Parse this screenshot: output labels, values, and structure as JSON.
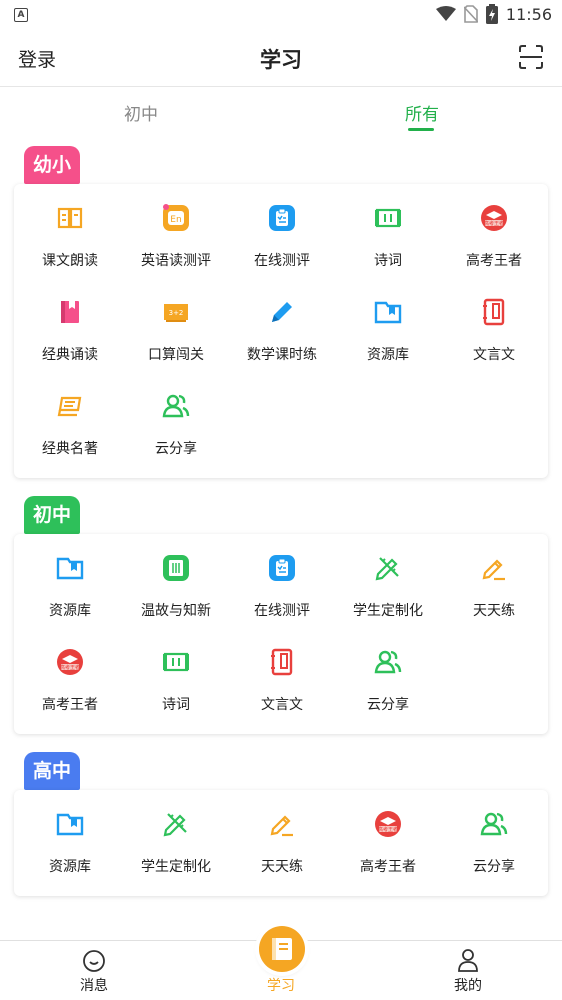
{
  "status_bar": {
    "left_icon": "A",
    "time": "11:56"
  },
  "header": {
    "login_label": "登录",
    "title": "学习",
    "scan_icon": "scan-icon"
  },
  "tabs": [
    {
      "label": "初中",
      "active": false
    },
    {
      "label": "所有",
      "active": true
    }
  ],
  "colors": {
    "accent": "#22b04b",
    "orange": "#f5a623",
    "pink": "#f5508a",
    "green": "#2ec05a",
    "blue": "#4a7cf0"
  },
  "sections": [
    {
      "badge": "幼小",
      "items": [
        {
          "label": "课文朗读",
          "icon": "book-open-icon"
        },
        {
          "label": "英语读测评",
          "icon": "english-en-icon"
        },
        {
          "label": "在线测评",
          "icon": "clipboard-icon"
        },
        {
          "label": "诗词",
          "icon": "scroll-icon"
        },
        {
          "label": "高考王者",
          "icon": "graduation-cap-icon"
        },
        {
          "label": "经典诵读",
          "icon": "red-book-icon"
        },
        {
          "label": "口算闯关",
          "icon": "blackboard-icon"
        },
        {
          "label": "数学课时练",
          "icon": "pencil-icon"
        },
        {
          "label": "资源库",
          "icon": "folder-icon"
        },
        {
          "label": "文言文",
          "icon": "notebook-icon"
        },
        {
          "label": "经典名著",
          "icon": "books-stack-icon"
        },
        {
          "label": "云分享",
          "icon": "users-icon"
        }
      ]
    },
    {
      "badge": "初中",
      "items": [
        {
          "label": "资源库",
          "icon": "folder-icon"
        },
        {
          "label": "温故与知新",
          "icon": "green-book-icon"
        },
        {
          "label": "在线测评",
          "icon": "clipboard-icon"
        },
        {
          "label": "学生定制化",
          "icon": "pencil-ruler-icon"
        },
        {
          "label": "天天练",
          "icon": "edit-icon"
        },
        {
          "label": "高考王者",
          "icon": "graduation-cap-icon"
        },
        {
          "label": "诗词",
          "icon": "scroll-icon"
        },
        {
          "label": "文言文",
          "icon": "notebook-icon"
        },
        {
          "label": "云分享",
          "icon": "users-icon"
        }
      ]
    },
    {
      "badge": "高中",
      "items": [
        {
          "label": "资源库",
          "icon": "folder-icon"
        },
        {
          "label": "学生定制化",
          "icon": "pencil-ruler-icon"
        },
        {
          "label": "天天练",
          "icon": "edit-icon"
        },
        {
          "label": "高考王者",
          "icon": "graduation-cap-icon"
        },
        {
          "label": "云分享",
          "icon": "users-icon"
        }
      ]
    }
  ],
  "bottom_nav": [
    {
      "label": "消息",
      "icon": "smile-icon",
      "active": false
    },
    {
      "label": "学习",
      "icon": "book-icon",
      "active": true
    },
    {
      "label": "我的",
      "icon": "person-icon",
      "active": false
    }
  ]
}
